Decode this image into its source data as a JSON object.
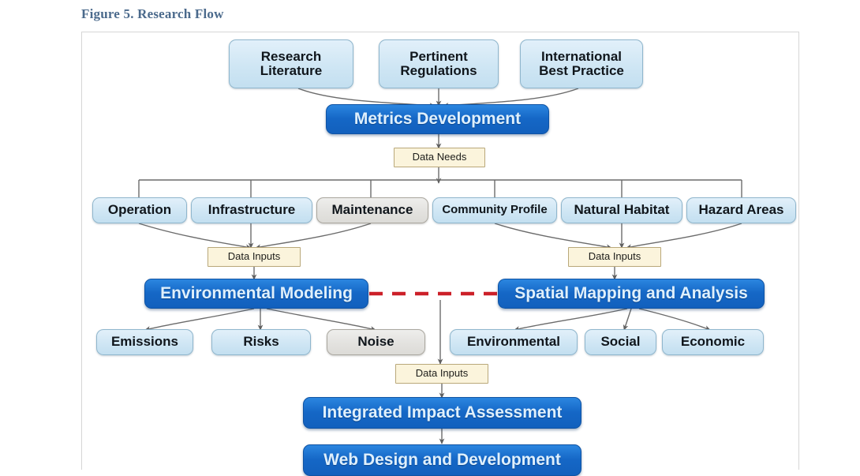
{
  "figure": {
    "title": "Figure 5. Research Flow",
    "title_color": "#4b6a8c"
  },
  "colors": {
    "light_blue_fill": "#cfe6f4",
    "light_blue_border": "#8fb6cd",
    "grey_fill": "#e3e2df",
    "grey_border": "#aaa79f",
    "dark_blue_fill": "#1567c6",
    "dark_blue_text": "#dff0fd",
    "cream_fill": "#fbf4dc",
    "cream_border": "#b9a87a",
    "connector": "#6b6b6b",
    "dashed_link": "#cc2029",
    "frame_border": "#d6d6d6"
  },
  "nodes": {
    "research_literature": "Research\nLiterature",
    "pertinent_regulations": "Pertinent\nRegulations",
    "international_best_practice": "International\nBest Practice",
    "metrics_development": "Metrics Development",
    "data_needs": "Data Needs",
    "operation": "Operation",
    "infrastructure": "Infrastructure",
    "maintenance": "Maintenance",
    "community_profile": "Community Profile",
    "natural_habitat": "Natural Habitat",
    "hazard_areas": "Hazard Areas",
    "data_inputs_left": "Data Inputs",
    "data_inputs_right": "Data Inputs",
    "environmental_modeling": "Environmental Modeling",
    "spatial_mapping": "Spatial Mapping and Analysis",
    "emissions": "Emissions",
    "risks": "Risks",
    "noise": "Noise",
    "environmental": "Environmental",
    "social": "Social",
    "economic": "Economic",
    "data_inputs_bottom": "Data Inputs",
    "integrated_impact_assessment": "Integrated Impact Assessment",
    "web_design_development": "Web Design and Development"
  }
}
